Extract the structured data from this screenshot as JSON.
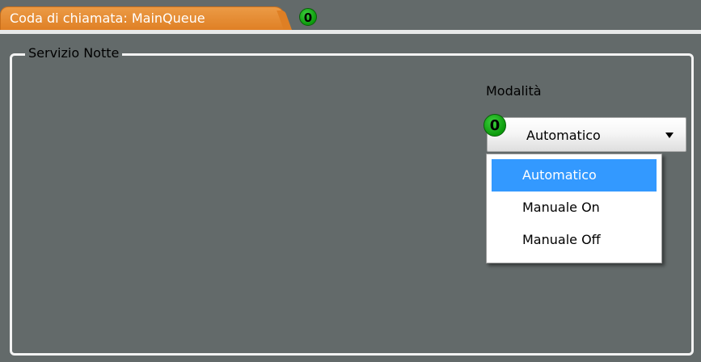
{
  "tab": {
    "label": "Coda di chiamata: MainQueue",
    "counter": "0"
  },
  "group": {
    "title": "Servizio Notte"
  },
  "mode": {
    "label": "Modalità",
    "counter": "0",
    "selected": "Automatico",
    "options": [
      {
        "label": "Automatico",
        "selected": true
      },
      {
        "label": "Manuale On",
        "selected": false
      },
      {
        "label": "Manuale Off",
        "selected": false
      }
    ]
  },
  "colors": {
    "background": "#636a6a",
    "tab": "#e5893a",
    "counter_green": "#0b9a0b",
    "highlight": "#3399ff"
  },
  "icons": {
    "combo_arrow": "chevron-down-icon"
  }
}
